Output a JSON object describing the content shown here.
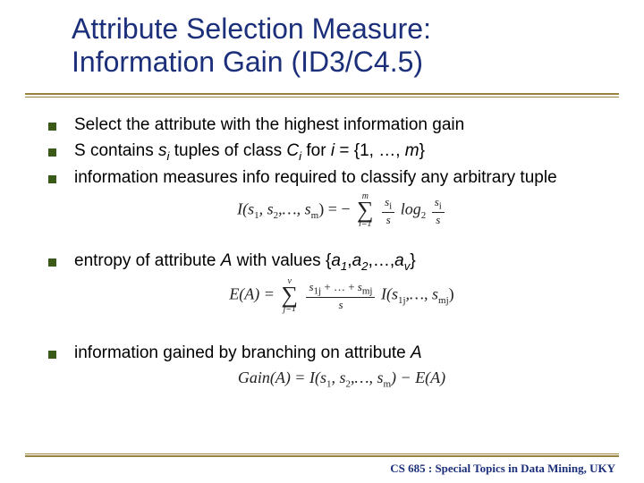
{
  "title_line1": "Attribute Selection Measure:",
  "title_line2": "Information Gain (ID3/C4.5)",
  "bullets": {
    "b1": "Select the attribute with the highest information gain",
    "b2_pre": "S contains ",
    "b2_var1": "s",
    "b2_sub1": "i",
    "b2_mid1": " tuples of class ",
    "b2_var2": "C",
    "b2_sub2": "i",
    "b2_mid2": " for ",
    "b2_var3": "i",
    "b2_post": " = {1, …, ",
    "b2_var4": "m",
    "b2_end": "}",
    "b3": "information measures info required to classify any arbitrary tuple",
    "b4_pre": "entropy of attribute ",
    "b4_var1": "A",
    "b4_mid": " with values {",
    "b4_a": "a",
    "b4_s1": "1",
    "b4_c1": ",",
    "b4_s2": "2",
    "b4_c2": ",…,",
    "b4_sv": "v",
    "b4_end": "}",
    "b5_pre": "information gained by branching on attribute ",
    "b5_var": "A"
  },
  "formulas": {
    "f1_lhs": "I(s",
    "f1_s1": "1",
    "f1_c": ", s",
    "f1_s2": "2",
    "f1_d": ",…, s",
    "f1_sm": "m",
    "f1_eq": ") = −",
    "f1_sig_top": "m",
    "f1_sig_bot": "i=1",
    "f1_num1": "s",
    "f1_nsub1": "i",
    "f1_den1": "s",
    "f1_log": " log",
    "f1_log2": "2",
    "f1_num2": "s",
    "f1_nsub2": "i",
    "f1_den2": "s",
    "f2_lhs": "E(A) = ",
    "f2_sig_top": "v",
    "f2_sig_bot": "j=1",
    "f2_num_a": "s",
    "f2_num_s1": "1j",
    "f2_num_plus": " + … + ",
    "f2_num_b": "s",
    "f2_num_s2": "mj",
    "f2_den": "s",
    "f2_rhs_a": " I(s",
    "f2_rhs_s1": "1j",
    "f2_rhs_b": ",…, s",
    "f2_rhs_s2": "mj",
    "f2_rhs_c": ")",
    "f3_lhs": "Gain(A) = I(s",
    "f3_s1": "1",
    "f3_a": ", s",
    "f3_s2": "2",
    "f3_b": ",…, s",
    "f3_sm": "m",
    "f3_c": ") − E(A)"
  },
  "footer": "CS 685 : Special Topics in Data Mining, UKY"
}
